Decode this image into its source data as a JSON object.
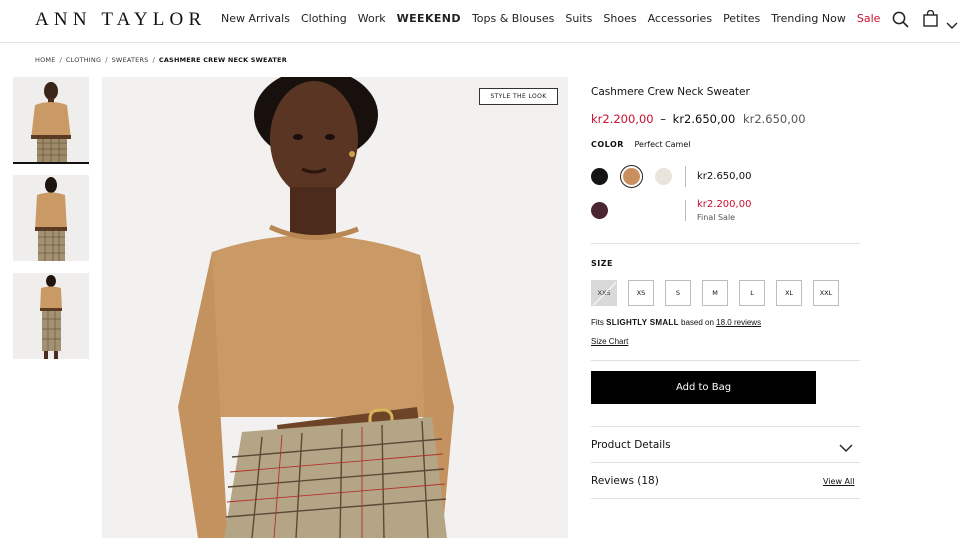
{
  "header": {
    "logo": "ANN TAYLOR",
    "nav": [
      {
        "label": "New Arrivals",
        "style": "normal"
      },
      {
        "label": "Clothing",
        "style": "normal"
      },
      {
        "label": "Work",
        "style": "normal"
      },
      {
        "label": "WEEKEND",
        "style": "bold"
      },
      {
        "label": "Tops & Blouses",
        "style": "normal"
      },
      {
        "label": "Suits",
        "style": "normal"
      },
      {
        "label": "Shoes",
        "style": "normal"
      },
      {
        "label": "Accessories",
        "style": "normal"
      },
      {
        "label": "Petites",
        "style": "normal"
      },
      {
        "label": "Trending Now",
        "style": "normal"
      },
      {
        "label": "Sale",
        "style": "sale"
      }
    ],
    "icons": [
      "search-icon",
      "shopping-bag-icon",
      "chevron-down-icon"
    ]
  },
  "breadcrumb": [
    "HOME",
    "CLOTHING",
    "SWEATERS",
    "CASHMERE CREW NECK SWEATER"
  ],
  "gallery": {
    "style_the_look": "STYLE THE LOOK"
  },
  "product": {
    "title": "Cashmere Crew Neck Sweater",
    "price_range_low": "kr2.200,00",
    "price_dash": "–",
    "price_range_high": "kr2.650,00",
    "price_original": "kr2.650,00",
    "color_label": "COLOR",
    "color_value": "Perfect Camel",
    "swatches": [
      {
        "name": "black",
        "hex": "#141414"
      },
      {
        "name": "perfect camel",
        "hex": "#c98f5e",
        "selected": true
      },
      {
        "name": "ivory",
        "hex": "#e9e4dc"
      },
      {
        "name": "plum",
        "hex": "#4a2633"
      }
    ],
    "swatch_price_1": "kr2.650,00",
    "swatch_price_2": "kr2.200,00",
    "swatch_price_2_note": "Final Sale",
    "size_label": "SIZE",
    "sizes": [
      "XXS",
      "XS",
      "S",
      "M",
      "L",
      "XL",
      "XXL"
    ],
    "fits_prefix": "Fits",
    "fits_value": "SLIGHTLY SMALL",
    "fits_middle": "based on",
    "fits_reviews": "18.0 reviews",
    "size_chart": "Size Chart",
    "add_to_bag": "Add to Bag",
    "product_details": "Product Details",
    "reviews": "Reviews (18)",
    "view_all": "View All"
  },
  "colors": {
    "accent_red": "#c8102e",
    "button_black": "#000000"
  }
}
